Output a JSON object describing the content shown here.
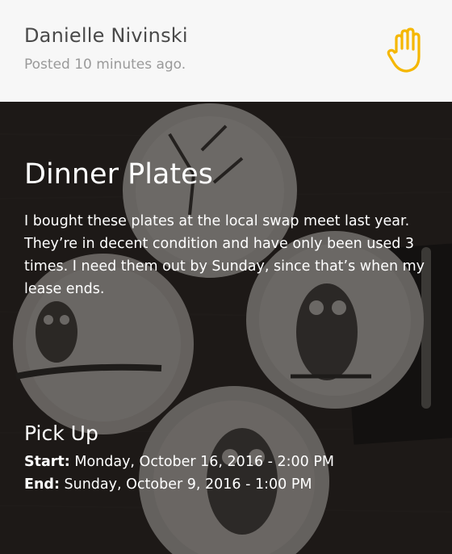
{
  "header": {
    "poster_name": "Danielle Nivinski",
    "posted_time": "Posted 10 minutes ago.",
    "hand_icon": "raised-hand-icon",
    "accent_color": "#F5B700"
  },
  "listing": {
    "title": "Dinner Plates",
    "description": "I bought these plates at the local swap meet last year. They’re in decent condition and have only been used 3 times. I need them out by Sunday, since that’s when my lease ends.",
    "image_subject": "dinner-plates-photo"
  },
  "pickup": {
    "heading": "Pick Up",
    "start_label": "Start:",
    "start_value": " Monday, October 16, 2016 - 2:00 PM",
    "end_label": "End:",
    "end_value": " Sunday, October 9, 2016 - 1:00 PM"
  }
}
